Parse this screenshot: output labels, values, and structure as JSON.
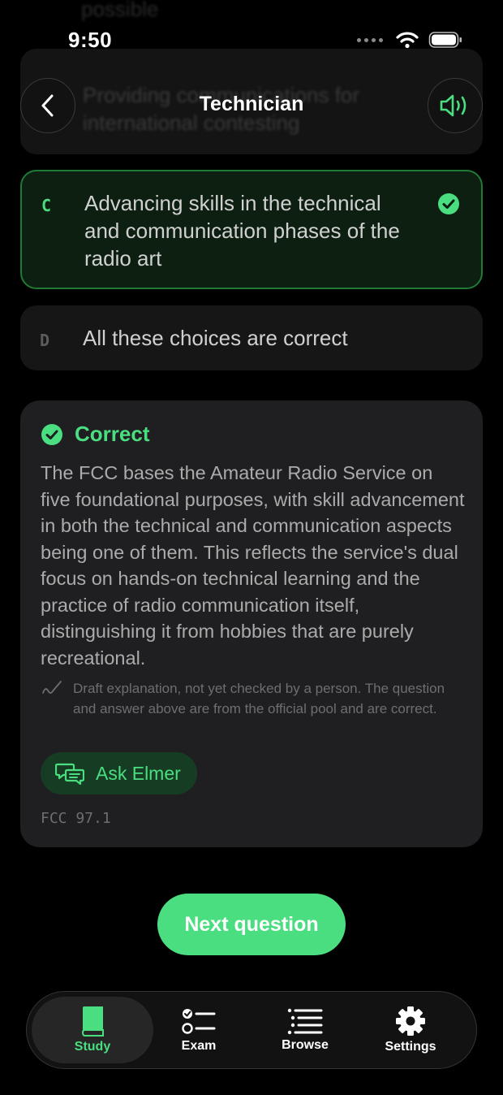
{
  "status_bar": {
    "time": "9:50"
  },
  "header": {
    "title": "Technician"
  },
  "previous_options": {
    "top_fragment": "possible",
    "text": "Providing communications for international contesting"
  },
  "options": [
    {
      "letter": "C",
      "text": "Advancing skills in the technical and communication phases of the radio art",
      "state": "correct"
    },
    {
      "letter": "D",
      "text": "All these choices are correct",
      "state": "neutral"
    }
  ],
  "explanation": {
    "status_label": "Correct",
    "body": "The FCC bases the Amateur Radio Service on five foundational purposes, with skill advancement in both the technical and communication aspects being one of them. This reflects the service's dual focus on hands-on technical learning and the practice of radio communication itself, distinguishing it from hobbies that are purely recreational.",
    "draft_note": "Draft explanation, not yet checked by a person. The question and answer above are from the official pool and are correct.",
    "ask_label": "Ask Elmer",
    "reference": "FCC 97.1"
  },
  "next_button": {
    "label": "Next question"
  },
  "tabs": [
    {
      "label": "Study",
      "icon": "book-icon",
      "active": true
    },
    {
      "label": "Exam",
      "icon": "checklist-icon",
      "active": false
    },
    {
      "label": "Browse",
      "icon": "list-icon",
      "active": false
    },
    {
      "label": "Settings",
      "icon": "gear-icon",
      "active": false
    }
  ],
  "colors": {
    "accent": "#4ade80",
    "correct_border": "#1f7a36",
    "card": "#1f1f21"
  }
}
